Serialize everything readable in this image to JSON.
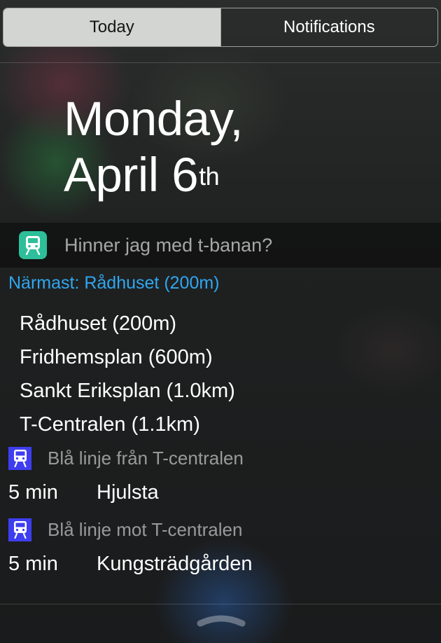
{
  "tabs": {
    "today": "Today",
    "notifications": "Notifications"
  },
  "date": {
    "weekday": "Monday,",
    "month_day": "April 6",
    "suffix": "th"
  },
  "widget": {
    "title": "Hinner jag med t-banan?",
    "icon": "train-icon",
    "accent_color": "#2dbf9a",
    "nearest": "Närmast: Rådhuset (200m)",
    "stations": [
      "Rådhuset (200m)",
      "Fridhemsplan (600m)",
      "Sankt Eriksplan (1.0km)",
      "T-Centralen (1.1km)"
    ],
    "lines": [
      {
        "label": "Blå linje från T-centralen",
        "icon": "metro-icon",
        "color": "#3e3ef0",
        "departure": {
          "time": "5 min",
          "destination": "Hjulsta"
        }
      },
      {
        "label": "Blå linje mot T-centralen",
        "icon": "metro-icon",
        "color": "#3e3ef0",
        "departure": {
          "time": "5 min",
          "destination": "Kungsträdgården"
        }
      }
    ]
  },
  "grabber_icon": "chevron-up-icon"
}
